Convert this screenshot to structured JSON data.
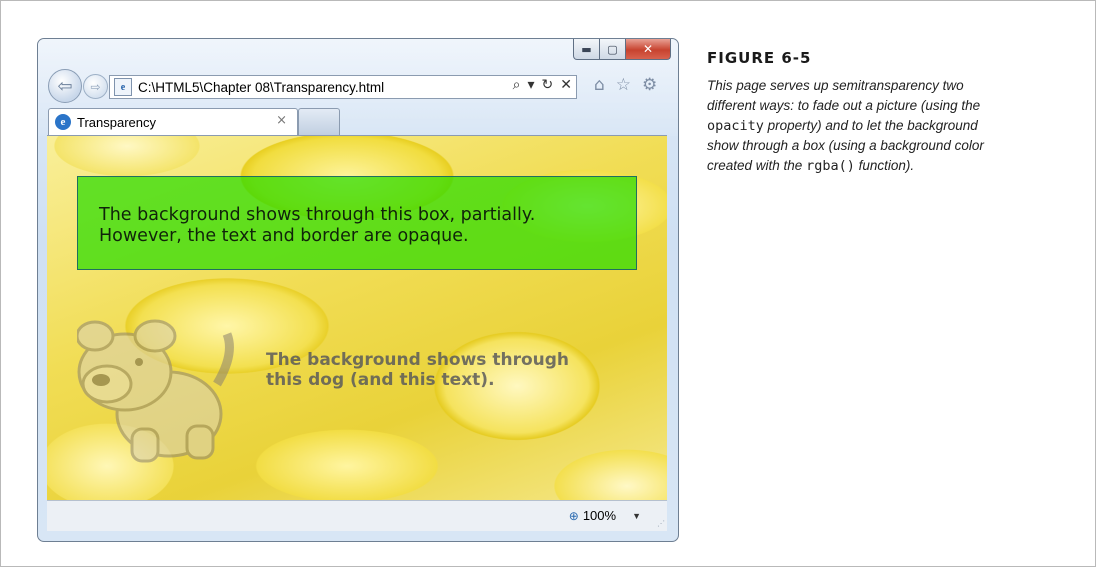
{
  "browser": {
    "caption_buttons": {
      "minimize": "▬",
      "maximize": "▢",
      "close": "✕"
    },
    "address_bar": {
      "url": "C:\\HTML5\\Chapter 08\\Transparency.html",
      "search_icon": "⌕",
      "dropdown_icon": "▾",
      "refresh_icon": "↻",
      "stop_icon": "✕"
    },
    "toolbar_icons": {
      "home": "⌂",
      "favorites": "☆",
      "tools": "⚙"
    },
    "tab": {
      "label": "Transparency",
      "close": "×"
    },
    "status_bar": {
      "zoom": "100%",
      "zoom_icon": "⊕",
      "zoom_arrow": "▼",
      "grip": "⋰"
    }
  },
  "page": {
    "green_box_lines": [
      "The background shows through this box, partially.",
      "However, the text and border are opaque."
    ],
    "dog_text_lines": [
      "The background shows through",
      "this dog (and this text)."
    ]
  },
  "figure": {
    "title": "FIGURE 6-5",
    "caption": {
      "l1": "This page serves up semitransparency two",
      "l2": "different ways: to fade out a picture (using the",
      "l3_code": "opacity",
      "l3_text": " property) and to let the background",
      "l4": "show through a box (using a background color",
      "l5_pre": "created with the ",
      "l5_code": "rgba()",
      "l5_post": " function)."
    }
  },
  "colors": {
    "green_box": "#28dc00",
    "lemon": "#f1dd3f",
    "ie_close_red": "#c7432f"
  }
}
